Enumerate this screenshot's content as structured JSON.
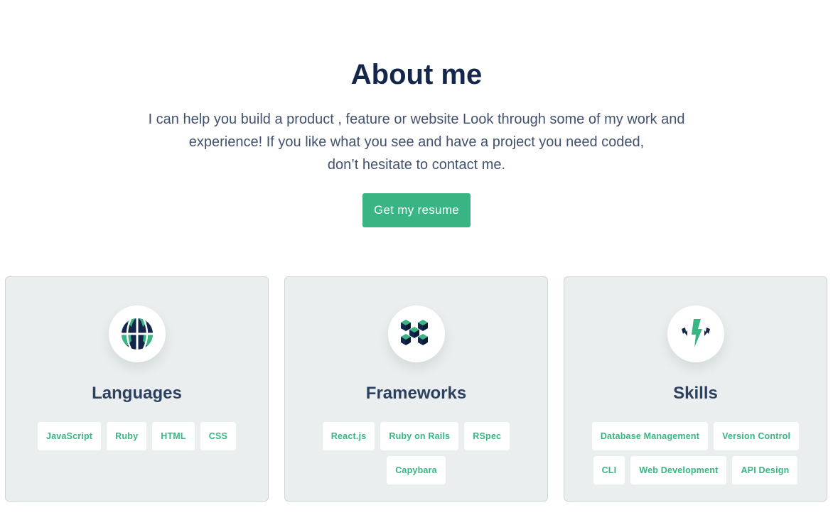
{
  "about": {
    "title": "About me",
    "description_lines": [
      "I can help you build a product , feature or website Look through some of my work and",
      "experience! If you like what you see and have a project you need coded,",
      "don’t hesitate to contact me."
    ],
    "resume_button": "Get my resume"
  },
  "cards": [
    {
      "title": "Languages",
      "icon": "globe-icon",
      "tag_rows": [
        [
          "JavaScript",
          "Ruby",
          "HTML",
          "CSS"
        ]
      ]
    },
    {
      "title": "Frameworks",
      "icon": "cubes-icon",
      "tag_rows": [
        [
          "React.js",
          "Ruby on Rails",
          "RSpec"
        ],
        [
          "Capybara"
        ]
      ]
    },
    {
      "title": "Skills",
      "icon": "lightning-icon",
      "tag_rows": [
        [
          "Database Management",
          "Version Control"
        ],
        [
          "CLI",
          "Web Development",
          "API Design"
        ]
      ]
    }
  ],
  "colors": {
    "accent": "#38b582",
    "heading": "#14264a",
    "text": "#42516d",
    "card_bg": "#eaeeee",
    "icon_dark": "#14264a"
  }
}
